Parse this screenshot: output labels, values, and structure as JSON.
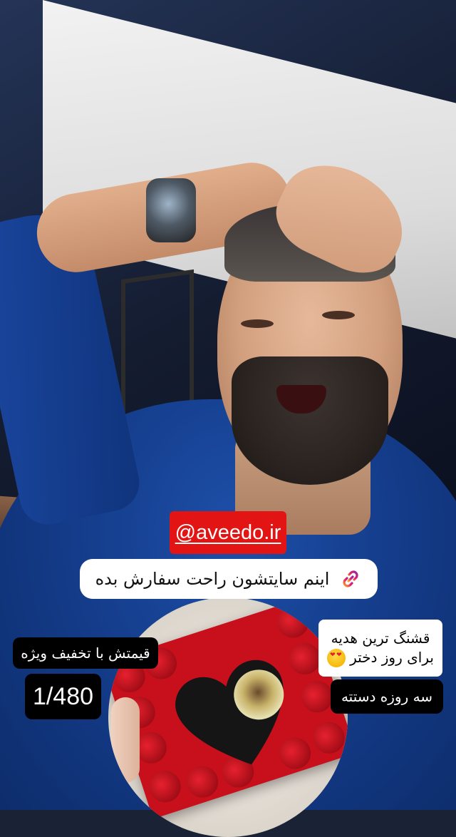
{
  "story": {
    "link_sticker": {
      "text": "@aveedo.ir",
      "color": "#e21414"
    },
    "caption": {
      "text": "اینم سایتشون راحت سفارش بده",
      "icon": "link-icon"
    },
    "price_label": "قیمتش با تخفیف ویژه",
    "price_value": "1/480",
    "gift_tag": {
      "line1": "قشنگ ترین هدیه",
      "line2": "برای روز دختر",
      "emoji": "heart-eyes-emoji"
    },
    "delivery_tag": "سه روزه دستته"
  }
}
